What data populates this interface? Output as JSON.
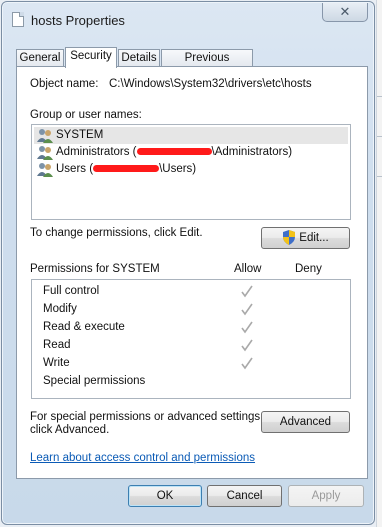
{
  "window": {
    "title": "hosts Properties",
    "close_glyph": "✕"
  },
  "tabs": [
    {
      "label": "General"
    },
    {
      "label": "Security",
      "active": true
    },
    {
      "label": "Details"
    },
    {
      "label": "Previous Versions"
    }
  ],
  "security": {
    "object_name_label": "Object name:",
    "object_name_value": "C:\\Windows\\System32\\drivers\\etc\\hosts",
    "groups_label": "Group or user names:",
    "groups": [
      {
        "prefix": "SYSTEM",
        "suffix": "",
        "redacted": false,
        "selected": true
      },
      {
        "prefix": "Administrators (",
        "suffix": "\\Administrators)",
        "redacted": true,
        "selected": false
      },
      {
        "prefix": "Users (",
        "suffix": "\\Users)",
        "redacted": true,
        "selected": false
      }
    ],
    "change_permissions_text": "To change permissions, click Edit.",
    "edit_button": "Edit...",
    "permissions_for_label": "Permissions for SYSTEM",
    "allow_header": "Allow",
    "deny_header": "Deny",
    "permissions": [
      {
        "name": "Full control",
        "allow": true,
        "deny": false
      },
      {
        "name": "Modify",
        "allow": true,
        "deny": false
      },
      {
        "name": "Read & execute",
        "allow": true,
        "deny": false
      },
      {
        "name": "Read",
        "allow": true,
        "deny": false
      },
      {
        "name": "Write",
        "allow": true,
        "deny": false
      },
      {
        "name": "Special permissions",
        "allow": false,
        "deny": false
      }
    ],
    "special_text_line1": "For special permissions or advanced settings,",
    "special_text_line2": "click Advanced.",
    "advanced_button": "Advanced",
    "learn_link": "Learn about access control and permissions"
  },
  "footer": {
    "ok": "OK",
    "cancel": "Cancel",
    "apply": "Apply"
  },
  "colors": {
    "link": "#0b5bb6",
    "redaction": "#ff1a1a",
    "check_disabled": "#a9a9a9"
  }
}
